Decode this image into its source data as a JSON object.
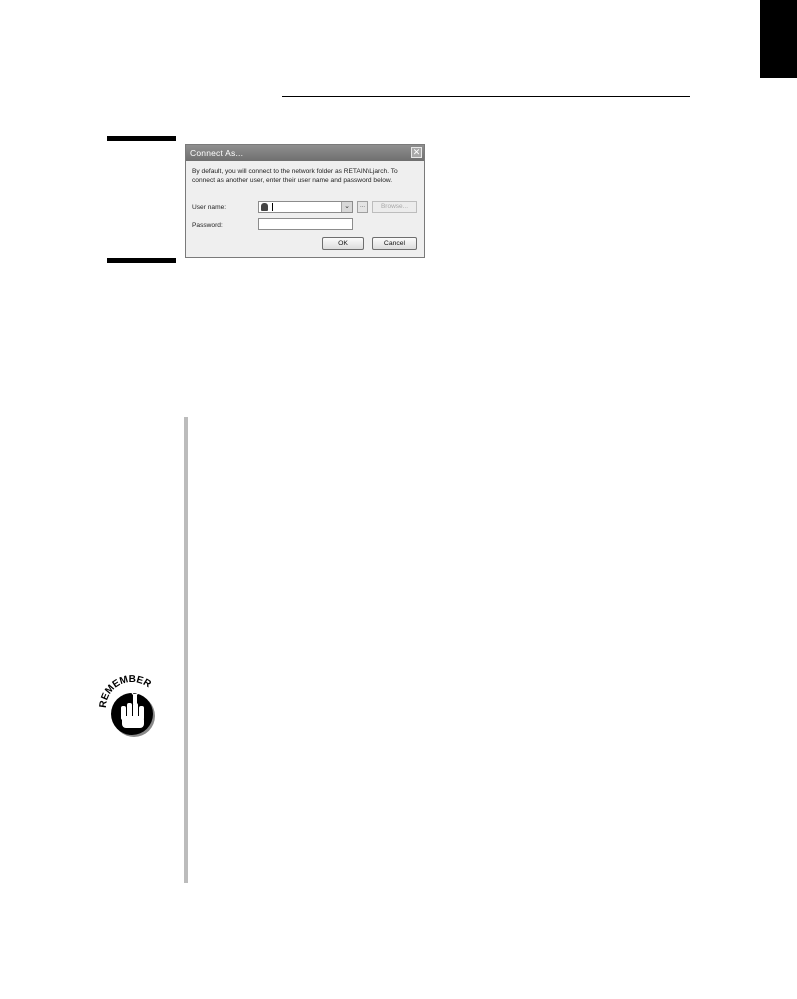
{
  "dialog": {
    "title": "Connect As...",
    "close_glyph": "✕",
    "intro_text": "By default, you will connect to the network folder as RETAIN\\Ljarch. To connect as another user, enter their user name and password below.",
    "user_label": "User name:",
    "user_value": "",
    "dropdown_glyph": "⌄",
    "ellipsis_label": "...",
    "browse_label": "Browse...",
    "password_label": "Password:",
    "password_value": "",
    "ok_label": "OK",
    "cancel_label": "Cancel"
  },
  "remember_icon": {
    "text": "REMEMBER"
  }
}
